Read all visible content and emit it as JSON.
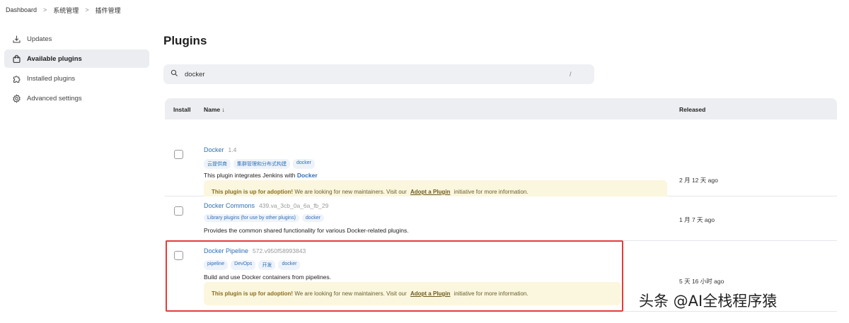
{
  "breadcrumb": [
    "Dashboard",
    "系统管理",
    "插件管理"
  ],
  "sidebar": {
    "items": [
      {
        "label": "Updates",
        "icon": "download-icon",
        "active": false
      },
      {
        "label": "Available plugins",
        "icon": "shopping-bag-icon",
        "active": true
      },
      {
        "label": "Installed plugins",
        "icon": "puzzle-icon",
        "active": false
      },
      {
        "label": "Advanced settings",
        "icon": "gear-icon",
        "active": false
      }
    ]
  },
  "page": {
    "title": "Plugins"
  },
  "search": {
    "value": "docker",
    "shortcut": "/"
  },
  "table": {
    "headers": {
      "install": "Install",
      "name": "Name ↓",
      "released": "Released"
    },
    "rows": [
      {
        "name": "Docker",
        "version": "1.4",
        "tags": [
          "云提供商",
          "集群管理和分布式构建",
          "docker"
        ],
        "description_prefix": "This plugin integrates Jenkins with ",
        "description_link": "Docker",
        "adoption": {
          "strong": "This plugin is up for adoption!",
          "text": " We are looking for new maintainers. Visit our ",
          "link": "Adopt a Plugin",
          "suffix": " initiative for more information."
        },
        "released": "2 月 12 天 ago"
      },
      {
        "name": "Docker Commons",
        "version": "439.va_3cb_0a_6a_fb_29",
        "tags": [
          "Library plugins (for use by other plugins)",
          "docker"
        ],
        "description": "Provides the common shared functionality for various Docker-related plugins.",
        "released": "1 月 7 天 ago"
      },
      {
        "name": "Docker Pipeline",
        "version": "572.v950f58993843",
        "tags": [
          "pipeline",
          "DevOps",
          "开发",
          "docker"
        ],
        "description": "Build and use Docker containers from pipelines.",
        "adoption": {
          "strong": "This plugin is up for adoption!",
          "text": " We are looking for new maintainers. Visit our ",
          "link": "Adopt a Plugin",
          "suffix": " initiative for more information."
        },
        "released": "5 天 16 小时 ago"
      }
    ]
  },
  "watermark": "头条 @AI全栈程序猿",
  "colors": {
    "link": "#2f6fb3",
    "highlight": "#e53b3b",
    "adoption_bg": "#fbf6de",
    "active_sidebar": "#ebedf1"
  }
}
